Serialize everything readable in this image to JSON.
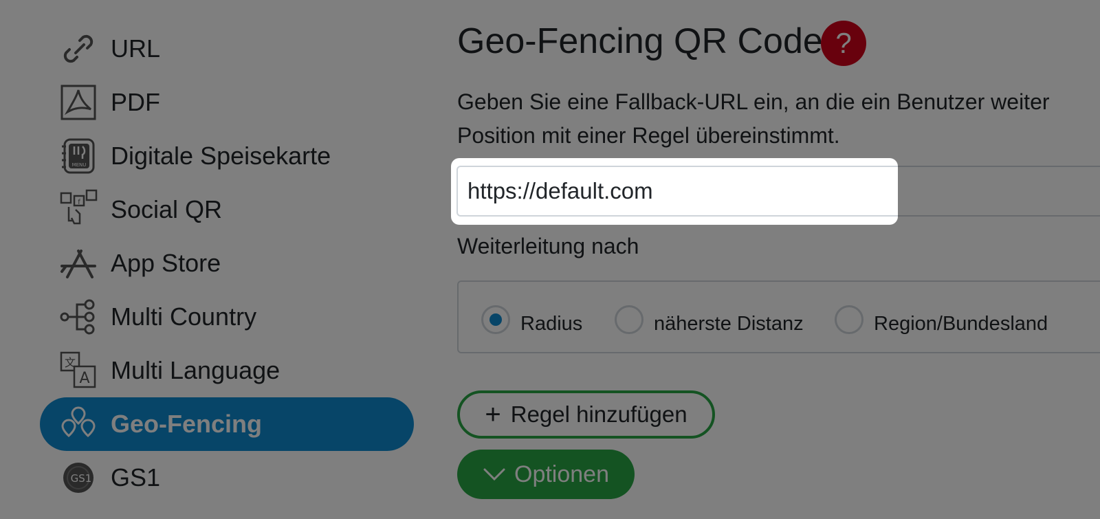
{
  "sidebar": {
    "items": [
      {
        "label": "URL",
        "icon": "link-icon"
      },
      {
        "label": "PDF",
        "icon": "pdf-icon"
      },
      {
        "label": "Digitale Speisekarte",
        "icon": "menu-icon"
      },
      {
        "label": "Social QR",
        "icon": "social-icon"
      },
      {
        "label": "App Store",
        "icon": "app-store-icon"
      },
      {
        "label": "Multi Country",
        "icon": "multi-country-icon"
      },
      {
        "label": "Multi Language",
        "icon": "language-icon"
      },
      {
        "label": "Geo-Fencing",
        "icon": "geo-fencing-icon",
        "active": true
      },
      {
        "label": "GS1",
        "icon": "gs1-icon"
      }
    ]
  },
  "main": {
    "title": "Geo-Fencing QR Code",
    "help_label": "?",
    "description_line1": "Geben Sie eine Fallback-URL ein, an die ein Benutzer weiter",
    "description_line2": "Position mit einer Regel übereinstimmt.",
    "fallback_url": {
      "value": "https://default.com"
    },
    "redirect_label": "Weiterleitung nach",
    "redirect_options": [
      {
        "label": "Radius",
        "selected": true
      },
      {
        "label": "näherste Distanz",
        "selected": false
      },
      {
        "label": "Region/Bundesland",
        "selected": false
      }
    ],
    "add_rule_label": "Regel hinzufügen",
    "options_label": "Optionen"
  },
  "colors": {
    "accent_blue": "#0e8ad1",
    "success_green": "#28a745",
    "help_red": "#d0021b"
  }
}
